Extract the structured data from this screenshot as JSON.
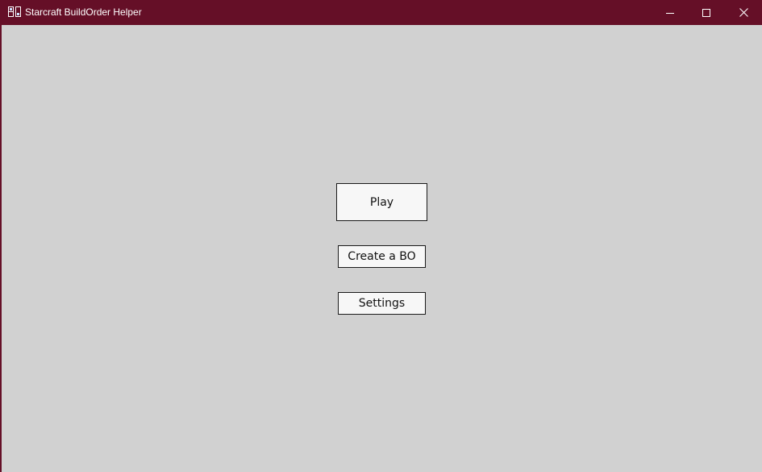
{
  "window": {
    "title": "Starcraft BuildOrder Helper",
    "icon": "buildorder-app-icon",
    "controls": {
      "minimize_icon": "minimize-icon",
      "maximize_icon": "maximize-icon",
      "close_icon": "close-icon"
    }
  },
  "menu": {
    "play_label": "Play",
    "create_label": "Create a BO",
    "settings_label": "Settings"
  },
  "colors": {
    "titlebar": "#650f27",
    "client_background": "#d1d1d1",
    "button_background": "#f7f7f7",
    "button_border": "#1a1a1a"
  }
}
